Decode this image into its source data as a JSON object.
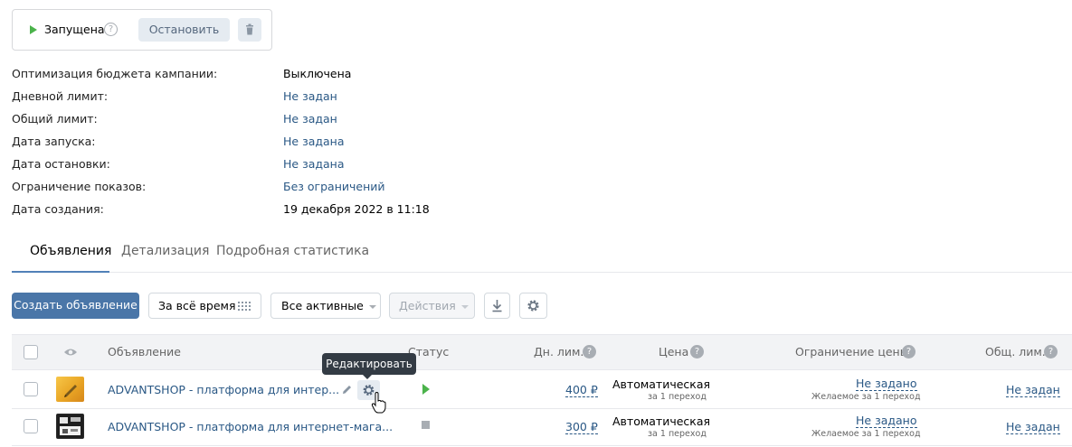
{
  "status_box": {
    "status": "Запущена",
    "help": "?",
    "stop_button": "Остановить"
  },
  "info": [
    {
      "label": "Оптимизация бюджета кампании:",
      "value": "Выключена"
    },
    {
      "label": "Дневной лимит:",
      "value": "Не задан"
    },
    {
      "label": "Общий лимит:",
      "value": "Не задан"
    },
    {
      "label": "Дата запуска:",
      "value": "Не задана"
    },
    {
      "label": "Дата остановки:",
      "value": "Не задана"
    },
    {
      "label": "Ограничение показов:",
      "value": "Без ограничений"
    },
    {
      "label": "Дата создания:",
      "value": "19 декабря 2022 в 11:18"
    }
  ],
  "tabs": [
    {
      "label": "Объявления",
      "active": true
    },
    {
      "label": "Детализация",
      "active": false
    },
    {
      "label": "Подробная статистика",
      "active": false
    }
  ],
  "toolbar": {
    "create": "Создать объявление",
    "period": "За всё время",
    "filter": "Все активные",
    "actions": "Действия"
  },
  "table": {
    "headers": {
      "ad": "Объявление",
      "status": "Статус",
      "daily": "Дн. лим.",
      "price": "Цена",
      "price_limit": "Ограничение цены",
      "total": "Общ. лим."
    },
    "help": "?",
    "rows": [
      {
        "title": "ADVANTSHOP - платформа для интер...",
        "status": "running",
        "daily": "400 ₽",
        "price": "Автоматическая",
        "price_sub": "за 1 переход",
        "price_limit": "Не задано",
        "price_limit_sub": "Желаемое за 1 переход",
        "total": "Не задан"
      },
      {
        "title": "ADVANTSHOP - платформа для интернет-мага...",
        "status": "stopped",
        "daily": "300 ₽",
        "price": "Автоматическая",
        "price_sub": "за 1 переход",
        "price_limit": "Не задано",
        "price_limit_sub": "Желаемое за 1 переход",
        "total": "Не задан"
      }
    ]
  },
  "tooltip": "Редактировать",
  "colors": {
    "accent": "#4a76a8",
    "link": "#2a5885",
    "running": "#4bb34b",
    "stopped": "#a8adb3"
  }
}
